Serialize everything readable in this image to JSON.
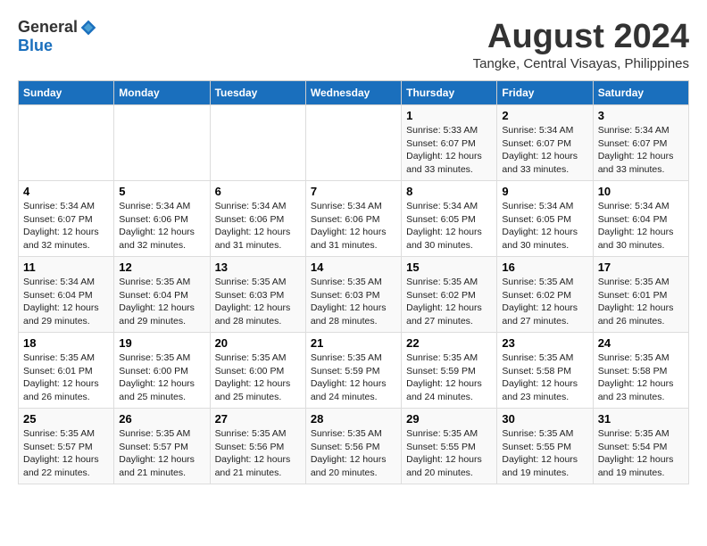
{
  "logo": {
    "general": "General",
    "blue": "Blue"
  },
  "title": "August 2024",
  "location": "Tangke, Central Visayas, Philippines",
  "headers": [
    "Sunday",
    "Monday",
    "Tuesday",
    "Wednesday",
    "Thursday",
    "Friday",
    "Saturday"
  ],
  "weeks": [
    [
      {
        "day": "",
        "content": ""
      },
      {
        "day": "",
        "content": ""
      },
      {
        "day": "",
        "content": ""
      },
      {
        "day": "",
        "content": ""
      },
      {
        "day": "1",
        "content": "Sunrise: 5:33 AM\nSunset: 6:07 PM\nDaylight: 12 hours\nand 33 minutes."
      },
      {
        "day": "2",
        "content": "Sunrise: 5:34 AM\nSunset: 6:07 PM\nDaylight: 12 hours\nand 33 minutes."
      },
      {
        "day": "3",
        "content": "Sunrise: 5:34 AM\nSunset: 6:07 PM\nDaylight: 12 hours\nand 33 minutes."
      }
    ],
    [
      {
        "day": "4",
        "content": "Sunrise: 5:34 AM\nSunset: 6:07 PM\nDaylight: 12 hours\nand 32 minutes."
      },
      {
        "day": "5",
        "content": "Sunrise: 5:34 AM\nSunset: 6:06 PM\nDaylight: 12 hours\nand 32 minutes."
      },
      {
        "day": "6",
        "content": "Sunrise: 5:34 AM\nSunset: 6:06 PM\nDaylight: 12 hours\nand 31 minutes."
      },
      {
        "day": "7",
        "content": "Sunrise: 5:34 AM\nSunset: 6:06 PM\nDaylight: 12 hours\nand 31 minutes."
      },
      {
        "day": "8",
        "content": "Sunrise: 5:34 AM\nSunset: 6:05 PM\nDaylight: 12 hours\nand 30 minutes."
      },
      {
        "day": "9",
        "content": "Sunrise: 5:34 AM\nSunset: 6:05 PM\nDaylight: 12 hours\nand 30 minutes."
      },
      {
        "day": "10",
        "content": "Sunrise: 5:34 AM\nSunset: 6:04 PM\nDaylight: 12 hours\nand 30 minutes."
      }
    ],
    [
      {
        "day": "11",
        "content": "Sunrise: 5:34 AM\nSunset: 6:04 PM\nDaylight: 12 hours\nand 29 minutes."
      },
      {
        "day": "12",
        "content": "Sunrise: 5:35 AM\nSunset: 6:04 PM\nDaylight: 12 hours\nand 29 minutes."
      },
      {
        "day": "13",
        "content": "Sunrise: 5:35 AM\nSunset: 6:03 PM\nDaylight: 12 hours\nand 28 minutes."
      },
      {
        "day": "14",
        "content": "Sunrise: 5:35 AM\nSunset: 6:03 PM\nDaylight: 12 hours\nand 28 minutes."
      },
      {
        "day": "15",
        "content": "Sunrise: 5:35 AM\nSunset: 6:02 PM\nDaylight: 12 hours\nand 27 minutes."
      },
      {
        "day": "16",
        "content": "Sunrise: 5:35 AM\nSunset: 6:02 PM\nDaylight: 12 hours\nand 27 minutes."
      },
      {
        "day": "17",
        "content": "Sunrise: 5:35 AM\nSunset: 6:01 PM\nDaylight: 12 hours\nand 26 minutes."
      }
    ],
    [
      {
        "day": "18",
        "content": "Sunrise: 5:35 AM\nSunset: 6:01 PM\nDaylight: 12 hours\nand 26 minutes."
      },
      {
        "day": "19",
        "content": "Sunrise: 5:35 AM\nSunset: 6:00 PM\nDaylight: 12 hours\nand 25 minutes."
      },
      {
        "day": "20",
        "content": "Sunrise: 5:35 AM\nSunset: 6:00 PM\nDaylight: 12 hours\nand 25 minutes."
      },
      {
        "day": "21",
        "content": "Sunrise: 5:35 AM\nSunset: 5:59 PM\nDaylight: 12 hours\nand 24 minutes."
      },
      {
        "day": "22",
        "content": "Sunrise: 5:35 AM\nSunset: 5:59 PM\nDaylight: 12 hours\nand 24 minutes."
      },
      {
        "day": "23",
        "content": "Sunrise: 5:35 AM\nSunset: 5:58 PM\nDaylight: 12 hours\nand 23 minutes."
      },
      {
        "day": "24",
        "content": "Sunrise: 5:35 AM\nSunset: 5:58 PM\nDaylight: 12 hours\nand 23 minutes."
      }
    ],
    [
      {
        "day": "25",
        "content": "Sunrise: 5:35 AM\nSunset: 5:57 PM\nDaylight: 12 hours\nand 22 minutes."
      },
      {
        "day": "26",
        "content": "Sunrise: 5:35 AM\nSunset: 5:57 PM\nDaylight: 12 hours\nand 21 minutes."
      },
      {
        "day": "27",
        "content": "Sunrise: 5:35 AM\nSunset: 5:56 PM\nDaylight: 12 hours\nand 21 minutes."
      },
      {
        "day": "28",
        "content": "Sunrise: 5:35 AM\nSunset: 5:56 PM\nDaylight: 12 hours\nand 20 minutes."
      },
      {
        "day": "29",
        "content": "Sunrise: 5:35 AM\nSunset: 5:55 PM\nDaylight: 12 hours\nand 20 minutes."
      },
      {
        "day": "30",
        "content": "Sunrise: 5:35 AM\nSunset: 5:55 PM\nDaylight: 12 hours\nand 19 minutes."
      },
      {
        "day": "31",
        "content": "Sunrise: 5:35 AM\nSunset: 5:54 PM\nDaylight: 12 hours\nand 19 minutes."
      }
    ]
  ]
}
